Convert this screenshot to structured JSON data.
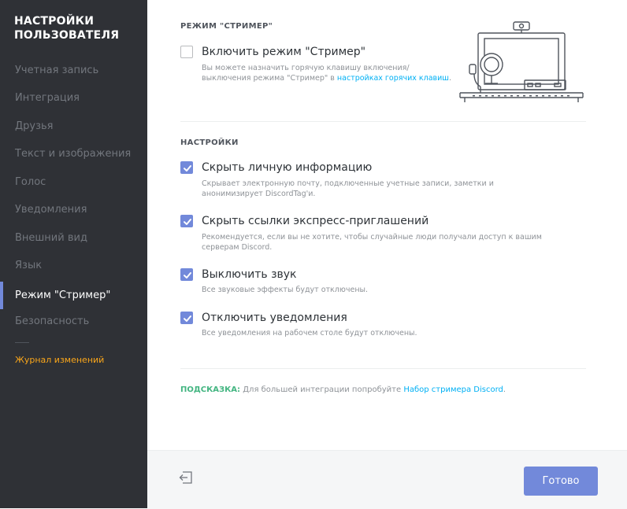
{
  "sidebar": {
    "title": "НАСТРОЙКИ ПОЛЬЗОВАТЕЛЯ",
    "items": [
      {
        "label": "Учетная запись"
      },
      {
        "label": "Интеграция"
      },
      {
        "label": "Друзья"
      },
      {
        "label": "Текст и изображения"
      },
      {
        "label": "Голос"
      },
      {
        "label": "Уведомления"
      },
      {
        "label": "Внешний вид"
      },
      {
        "label": "Язык"
      },
      {
        "label": "Режим \"Стример\"",
        "active": true
      },
      {
        "label": "Безопасность"
      }
    ],
    "changelog": "Журнал изменений"
  },
  "streamer": {
    "section_title": "РЕЖИМ \"СТРИМЕР\"",
    "enable_label": "Включить режим \"Стример\"",
    "enable_checked": false,
    "desc_prefix": "Вы можете назначить горячую клавишу включения/выключения режима \"Стример\" в",
    "desc_link": "настройках горячих клавиш",
    "desc_suffix": "."
  },
  "settings": {
    "section_title": "НАСТРОЙКИ",
    "options": [
      {
        "label": "Скрыть личную информацию",
        "desc": "Скрывает электронную почту, подключенные учетные записи, заметки и анонимизирует DiscordTag'и.",
        "checked": true
      },
      {
        "label": "Скрыть ссылки экспресс-приглашений",
        "desc": "Рекомендуется, если вы не хотите, чтобы случайные люди получали доступ к вашим серверам Discord.",
        "checked": true
      },
      {
        "label": "Выключить звук",
        "desc": "Все звуковые эффекты будут отключены.",
        "checked": true
      },
      {
        "label": "Отключить уведомления",
        "desc": "Все уведомления на рабочем столе будут отключены.",
        "checked": true
      }
    ]
  },
  "tip": {
    "label": "ПОДСКАЗКА:",
    "text": "Для большей интеграции попробуйте",
    "link": "Набор стримера Discord",
    "suffix": "."
  },
  "footer": {
    "done_label": "Готово"
  },
  "colors": {
    "accent": "#7289da",
    "sidebar_bg": "#2f3136",
    "tip_green": "#43b581",
    "link": "#00b0f4",
    "changelog": "#faa61a"
  }
}
